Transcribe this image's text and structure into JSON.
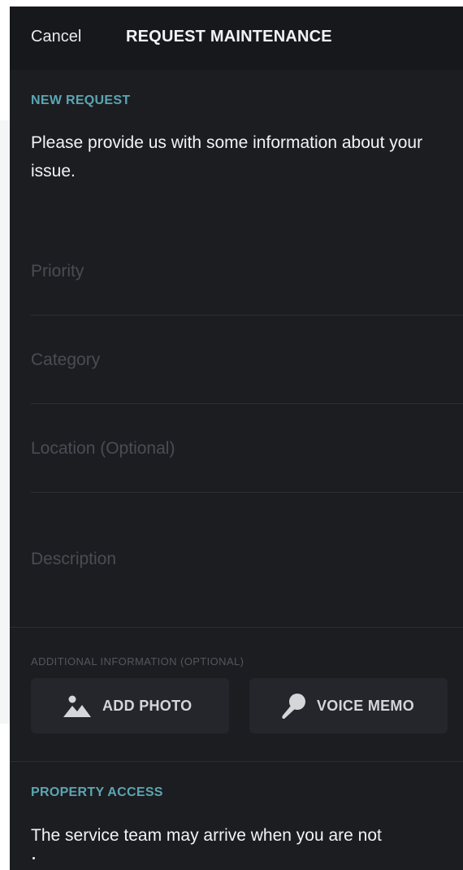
{
  "nav": {
    "cancel_label": "Cancel",
    "title": "REQUEST MAINTENANCE"
  },
  "new_request": {
    "section_label": "NEW REQUEST",
    "intro_text": "Please provide us with some information about your issue."
  },
  "fields": {
    "priority_placeholder": "Priority",
    "category_placeholder": "Category",
    "location_placeholder": "Location (Optional)",
    "description_placeholder": "Description"
  },
  "additional_info": {
    "label": "ADDITIONAL INFORMATION (OPTIONAL)",
    "add_photo_label": "ADD PHOTO",
    "add_photo_icon": "image-icon",
    "voice_memo_label": "VOICE MEMO",
    "voice_memo_icon": "microphone-icon"
  },
  "property_access": {
    "section_label": "PROPERTY ACCESS",
    "text": "The service team may arrive when you are not"
  },
  "colors": {
    "background": "#1c1d21",
    "nav_background": "#17181b",
    "accent": "#5aa6b3",
    "button_background": "#24262b",
    "placeholder": "#4a4c53"
  }
}
